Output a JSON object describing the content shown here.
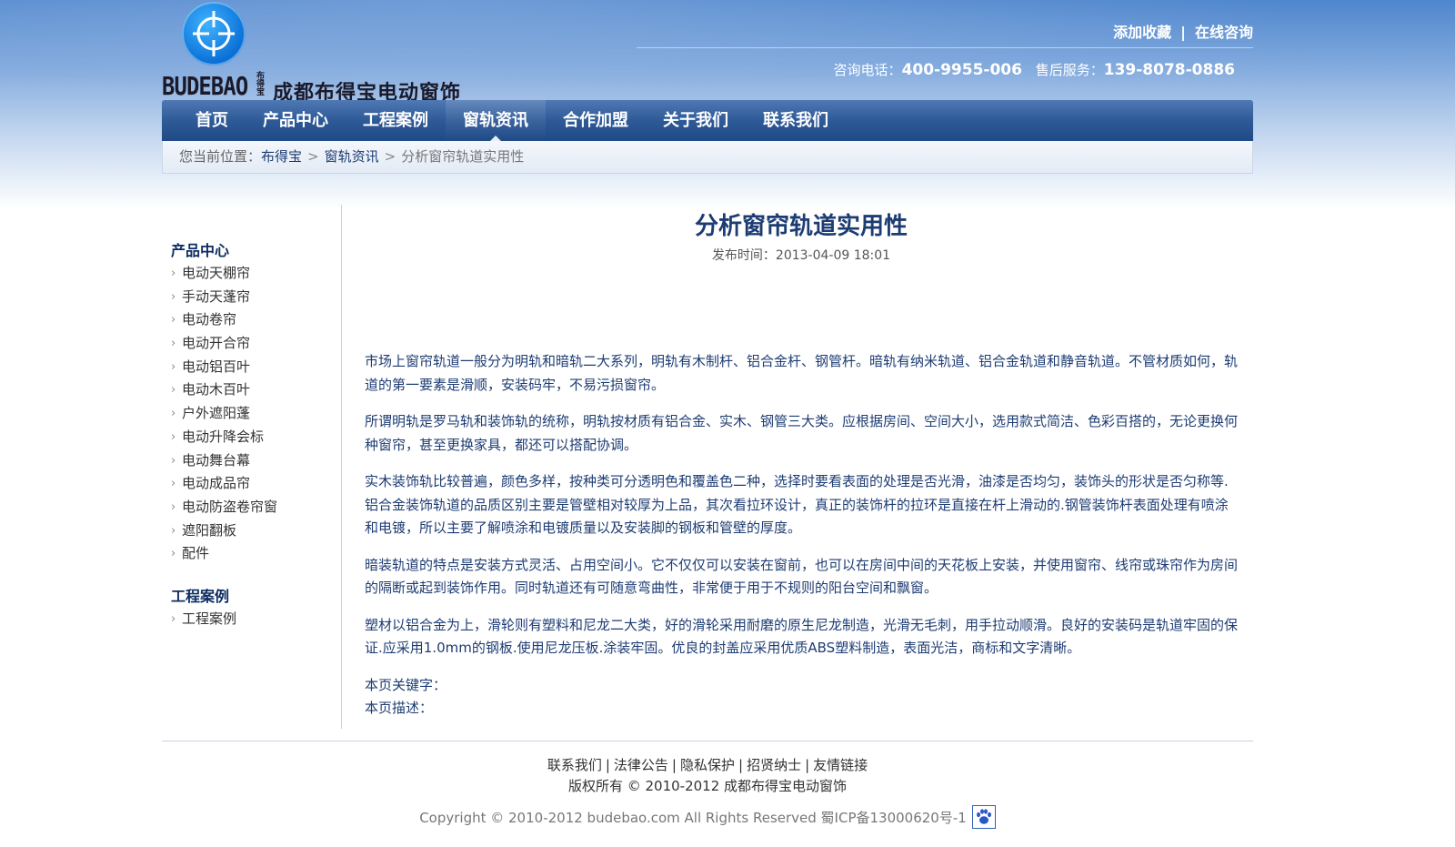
{
  "header": {
    "logo_en": "BUDEBAO",
    "logo_cn_small": "布得宝",
    "logo_cn": "成都布得宝电动窗饰",
    "top_links": [
      "添加收藏",
      "在线咨询"
    ],
    "consult_label": "咨询电话：",
    "consult_phone": "400-9955-006",
    "service_label": "售后服务：",
    "service_phone": "139-8078-0886"
  },
  "nav": {
    "items": [
      "首页",
      "产品中心",
      "工程案例",
      "窗轨资讯",
      "合作加盟",
      "关于我们",
      "联系我们"
    ],
    "active_index": 3
  },
  "breadcrumb": {
    "prefix": "您当前位置：",
    "items": [
      "布得宝",
      "窗轨资讯"
    ],
    "current": "分析窗帘轨道实用性",
    "separator": ">"
  },
  "sidebar": {
    "sections": [
      {
        "title": "产品中心",
        "items": [
          "电动天棚帘",
          "手动天蓬帘",
          "电动卷帘",
          "电动开合帘",
          "电动铝百叶",
          "电动木百叶",
          "户外遮阳蓬",
          "电动升降会标",
          "电动舞台幕",
          "电动成品帘",
          "电动防盗卷帘窗",
          "遮阳翻板",
          "配件"
        ]
      },
      {
        "title": "工程案例",
        "items": [
          "工程案例"
        ]
      }
    ]
  },
  "article": {
    "title": "分析窗帘轨道实用性",
    "date_label": "发布时间：",
    "date": "2013-04-09 18:01",
    "paragraphs": [
      "市场上窗帘轨道一般分为明轨和暗轨二大系列，明轨有木制杆、铝合金杆、钢管杆。暗轨有纳米轨道、铝合金轨道和静音轨道。不管材质如何，轨道的第一要素是滑顺，安装码牢，不易污损窗帘。",
      "所谓明轨是罗马轨和装饰轨的统称，明轨按材质有铝合金、实木、钢管三大类。应根据房间、空间大小，选用款式简洁、色彩百搭的，无论更换何种窗帘，甚至更换家具，都还可以搭配协调。",
      "实木装饰轨比较普遍，颜色多样，按种类可分透明色和覆盖色二种，选择时要看表面的处理是否光滑，油漆是否均匀，装饰头的形状是否匀称等.铝合金装饰轨道的品质区别主要是管壁相对较厚为上品，其次看拉环设计，真正的装饰杆的拉环是直接在杆上滑动的.钢管装饰杆表面处理有喷涂和电镀，所以主要了解喷涂和电镀质量以及安装脚的钢板和管壁的厚度。",
      "暗装轨道的特点是安装方式灵活、占用空间小。它不仅仅可以安装在窗前，也可以在房间中间的天花板上安装，并使用窗帘、线帘或珠帘作为房间的隔断或起到装饰作用。同时轨道还有可随意弯曲性，非常便于用于不规则的阳台空间和飘窗。",
      "塑材以铝合金为上，滑轮则有塑料和尼龙二大类，好的滑轮采用耐磨的原生尼龙制造，光滑无毛刺，用手拉动顺滑。良好的安装码是轨道牢固的保证.应采用1.0mm的钢板.使用尼龙压板.涂装牢固。优良的封盖应采用优质ABS塑料制造，表面光洁，商标和文字清晰。"
    ],
    "keywords_label": "本页关键字：",
    "description_label": "本页描述："
  },
  "footer": {
    "links": [
      "联系我们",
      "法律公告",
      "隐私保护",
      "招贤纳士",
      "友情链接"
    ],
    "copyright_cn": "版权所有 © 2010-2012 成都布得宝电动窗饰",
    "copyright_en": "Copyright © 2010-2012 budebao.com All Rights Reserved 蜀ICP备13000620号-1",
    "badge_icon": "paw-icon"
  }
}
